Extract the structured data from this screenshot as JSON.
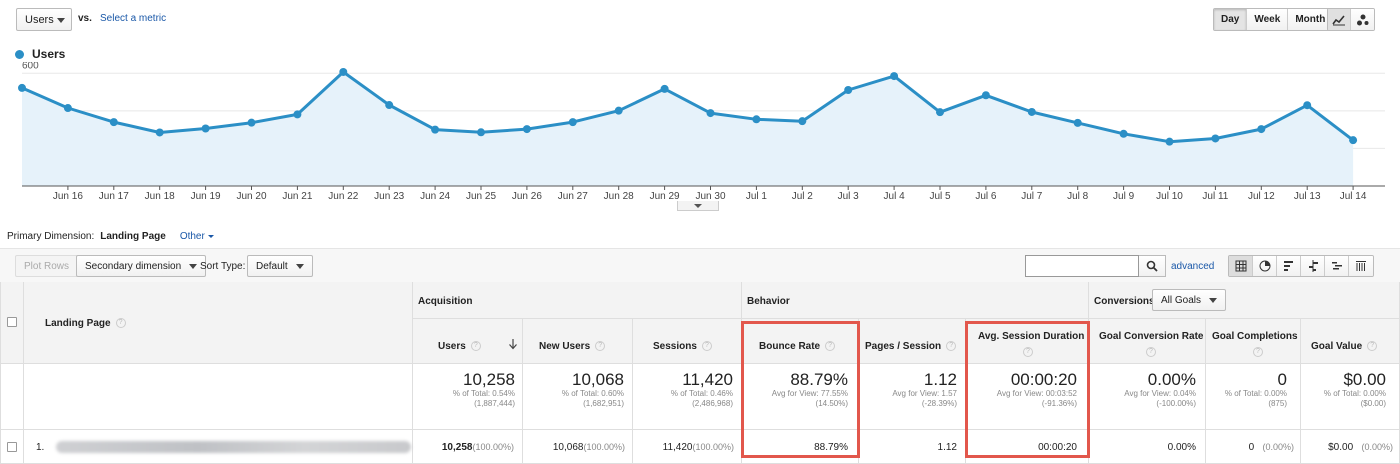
{
  "top": {
    "metric": "Users",
    "vs": "vs.",
    "select_metric": "Select a metric",
    "periods": [
      "Day",
      "Week",
      "Month"
    ],
    "active_period": "Day",
    "chart_type_icons": [
      "line-chart-icon",
      "motion-chart-icon"
    ]
  },
  "chart_data": {
    "type": "area",
    "series": [
      {
        "name": "Users",
        "color": "#2b8fc6",
        "values": [
          522,
          415,
          340,
          285,
          306,
          337,
          381,
          607,
          431,
          300,
          286,
          303,
          340,
          401,
          517,
          388,
          355,
          345,
          511,
          585,
          393,
          483,
          394,
          336,
          278,
          236,
          253,
          303,
          430,
          244
        ]
      }
    ],
    "x_ticks": [
      "Jun 16",
      "Jun 17",
      "Jun 18",
      "Jun 19",
      "Jun 20",
      "Jun 21",
      "Jun 22",
      "Jun 23",
      "Jun 24",
      "Jun 25",
      "Jun 26",
      "Jun 27",
      "Jun 28",
      "Jun 29",
      "Jun 30",
      "Jul 1",
      "Jul 2",
      "Jul 3",
      "Jul 4",
      "Jul 5",
      "Jul 6",
      "Jul 7",
      "Jul 8",
      "Jul 9",
      "Jul 10",
      "Jul 11",
      "Jul 12",
      "Jul 13",
      "Jul 14"
    ],
    "y_ticks": [
      "600",
      "400",
      "200"
    ],
    "ylim": [
      0,
      660
    ],
    "grid": true,
    "legend": "top-left"
  },
  "primary_dimension": {
    "label": "Primary Dimension:",
    "value": "Landing Page",
    "other": "Other"
  },
  "toolbar": {
    "plot_rows": "Plot Rows",
    "secondary_dimension": "Secondary dimension",
    "sort_type_label": "Sort Type:",
    "sort_type_value": "Default",
    "search_placeholder": "",
    "advanced": "advanced"
  },
  "table": {
    "landing_page_header": "Landing Page",
    "sections": {
      "acquisition": "Acquisition",
      "behavior": "Behavior",
      "conversions": "Conversions",
      "goals_select": "All Goals"
    },
    "columns": {
      "users": "Users",
      "new_users": "New Users",
      "sessions": "Sessions",
      "bounce_rate": "Bounce Rate",
      "pages_session": "Pages / Session",
      "avg_duration": "Avg. Session Duration",
      "goal_conv_rate": "Goal Conversion Rate",
      "goal_completions": "Goal Completions",
      "goal_value": "Goal Value"
    },
    "totals": {
      "users": {
        "value": "10,258",
        "line1": "% of Total: 0.54%",
        "line2": "(1,887,444)"
      },
      "new_users": {
        "value": "10,068",
        "line1": "% of Total: 0.60%",
        "line2": "(1,682,951)"
      },
      "sessions": {
        "value": "11,420",
        "line1": "% of Total: 0.46%",
        "line2": "(2,486,968)"
      },
      "bounce_rate": {
        "value": "88.79%",
        "line1": "Avg for View: 77.55%",
        "line2": "(14.50%)"
      },
      "pages_session": {
        "value": "1.12",
        "line1": "Avg for View: 1.57",
        "line2": "(-28.39%)"
      },
      "avg_duration": {
        "value": "00:00:20",
        "line1": "Avg for View: 00:03:52",
        "line2": "(-91.36%)"
      },
      "goal_conv_rate": {
        "value": "0.00%",
        "line1": "Avg for View: 0.04%",
        "line2": "(-100.00%)"
      },
      "goal_completions": {
        "value": "0",
        "line1": "% of Total: 0.00%",
        "line2": "(875)"
      },
      "goal_value": {
        "value": "$0.00",
        "line1": "% of Total: 0.00%",
        "line2": "($0.00)"
      }
    },
    "rows": [
      {
        "index": "1.",
        "users": "10,258",
        "users_pct": "(100.00%)",
        "new_users": "10,068",
        "new_users_pct": "(100.00%)",
        "sessions": "11,420",
        "sessions_pct": "(100.00%)",
        "bounce_rate": "88.79%",
        "pages_session": "1.12",
        "avg_duration": "00:00:20",
        "goal_conv_rate": "0.00%",
        "goal_completions": "0",
        "goal_completions_pct": "(0.00%)",
        "goal_value": "$0.00",
        "goal_value_pct": "(0.00%)"
      }
    ]
  },
  "colors": {
    "series": "#2b8fc6",
    "area": "#e6f2fa",
    "highlight": "#e2574c",
    "link": "#1a58a8"
  }
}
